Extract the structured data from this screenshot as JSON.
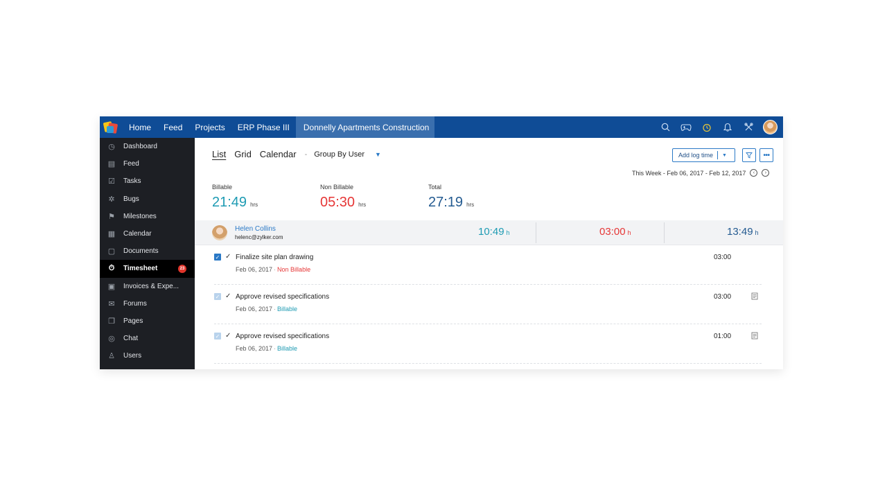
{
  "topbar": {
    "nav": [
      "Home",
      "Feed",
      "Projects",
      "ERP Phase III",
      "Donnelly Apartments Construction"
    ],
    "icons": [
      "search-icon",
      "gamepad-icon",
      "alarm-clock-icon",
      "bell-icon",
      "tools-icon"
    ]
  },
  "sidebar": {
    "items": [
      {
        "label": "Dashboard",
        "icon": "dashboard-icon",
        "glyph": "◷"
      },
      {
        "label": "Feed",
        "icon": "feed-icon",
        "glyph": "▤"
      },
      {
        "label": "Tasks",
        "icon": "tasks-icon",
        "glyph": "☑"
      },
      {
        "label": "Bugs",
        "icon": "bug-icon",
        "glyph": "✲"
      },
      {
        "label": "Milestones",
        "icon": "signpost-icon",
        "glyph": "⚑"
      },
      {
        "label": "Calendar",
        "icon": "calendar-icon",
        "glyph": "▦"
      },
      {
        "label": "Documents",
        "icon": "folder-icon",
        "glyph": "▢"
      },
      {
        "label": "Timesheet",
        "icon": "stopwatch-icon",
        "glyph": "⏱",
        "badge": "23",
        "active": true
      },
      {
        "label": "Invoices & Expe...",
        "icon": "invoice-icon",
        "glyph": "▣"
      },
      {
        "label": "Forums",
        "icon": "forums-icon",
        "glyph": "✉"
      },
      {
        "label": "Pages",
        "icon": "pages-icon",
        "glyph": "❐"
      },
      {
        "label": "Chat",
        "icon": "chat-icon",
        "glyph": "◎"
      },
      {
        "label": "Users",
        "icon": "users-icon",
        "glyph": "♙"
      }
    ]
  },
  "main": {
    "views": {
      "list": "List",
      "grid": "Grid",
      "calendar": "Calendar",
      "separator": "-",
      "group": "Group By User"
    },
    "add_log_time": "Add log time",
    "range": "This Week - Feb 06, 2017 - Feb 12, 2017",
    "stats": [
      {
        "label": "Billable",
        "value": "21:49",
        "unit": "hrs",
        "color": "#1e9bb3"
      },
      {
        "label": "Non Billable",
        "value": "05:30",
        "unit": "hrs",
        "color": "#e63636"
      },
      {
        "label": "Total",
        "value": "27:19",
        "unit": "hrs",
        "color": "#245b91"
      }
    ],
    "user": {
      "name": "Helen Collins",
      "email": "helenc@zylker.com",
      "billable": "10:49",
      "non_billable": "03:00",
      "total": "13:49",
      "unit": "h"
    },
    "tasks": [
      {
        "name": "Finalize site plan drawing",
        "date": "Feb 06, 2017",
        "type": "Non Billable",
        "time": "03:00",
        "note": false
      },
      {
        "name": "Approve revised specifications",
        "date": "Feb 06, 2017",
        "type": "Billable",
        "time": "03:00",
        "note": true
      },
      {
        "name": "Approve revised specifications",
        "date": "Feb 06, 2017",
        "type": "Billable",
        "time": "01:00",
        "note": true
      }
    ]
  }
}
